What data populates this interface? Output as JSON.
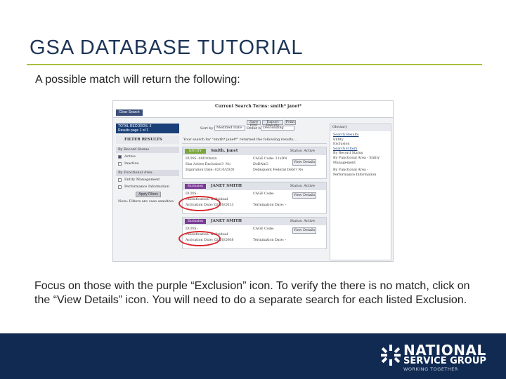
{
  "slide": {
    "title": "GSA DATABASE TUTORIAL",
    "intro": "A possible match will return the following:",
    "body": "Focus on those with the purple “Exclusion” icon.  To verify the there is no match, click on the “View Details” icon.   You will need to do a separate search for each listed Exclusion."
  },
  "screenshot": {
    "clear_search": "Clear Search",
    "search_terms": "Current Search Terms: smith* janet*",
    "total_records": "TOTAL RECORDS: 3",
    "results_page": "Results page 1 of 1",
    "sort_by_label": "Sort by",
    "sort_by_value": "Modified Date",
    "order_by_label": "Order by",
    "order_by_value": "Descending",
    "save_pdf": "Save PDF",
    "export_results": "Export Results",
    "print": "Print",
    "filter_results": "FILTER RESULTS",
    "returned_text": "Your search for \"smith* janet*\" returned the following results...",
    "record_status_hdr": "By Record Status",
    "active": "Active",
    "inactive": "Inactive",
    "functional_area_hdr": "By Functional Area",
    "entity_management": "Entity Management",
    "performance_information": "Performance Information",
    "apply_filters": "Apply Filters",
    "filters_note": "Note: Filters are case sensitive",
    "cards": [
      {
        "tag": "ENTITY",
        "name": "Smith, Janet",
        "status": "Status: Active",
        "duns": "DUNS: 00010xxxx",
        "cage": "CAGE Code: 11xDN",
        "has_excl": "Has Active Exclusion?: No",
        "dodaac": "DoDAAC:",
        "expiration": "Expiration Date: 02/10/2020",
        "delinquent": "Delinquent Federal Debt? No",
        "button": "View Details"
      },
      {
        "tag": "Exclusion",
        "name": "JANET SMITH",
        "status": "Status: Active",
        "duns": "DUNS:",
        "cage": "CAGE Code:",
        "classification": "Classification: Individual",
        "activation": "Activation Date: 02/20/2013",
        "termination": "Termination Date: -",
        "button": "View Details"
      },
      {
        "tag": "Exclusion",
        "name": "JANET SMITH",
        "status": "Status: Active",
        "duns": "DUNS:",
        "cage": "CAGE Code:",
        "classification": "Classification: Individual",
        "activation": "Activation Date: 02/20/2008",
        "termination": "Termination Date: -",
        "button": "View Details"
      }
    ],
    "glossary": {
      "header": "Glossary",
      "search_results": "Search Results",
      "entity": "Entity",
      "exclusion": "Exclusion",
      "search_filters": "Search Filters",
      "by_record_status": "By Record Status",
      "by_func_entity": "By Functional Area - Entity Management",
      "by_func_perf": "By Functional Area - Performance Information"
    }
  },
  "footer": {
    "logo_line1": "NATIONAL",
    "logo_line2": "SERVICE GROUP",
    "logo_line3": "WORKING TOGETHER"
  },
  "colors": {
    "title": "#1d3557",
    "rule": "#a7c040",
    "footer_bg": "#102a52",
    "exclusion_tag": "#7a3a96",
    "entity_tag": "#7aa63c",
    "highlight_oval": "#d6262b"
  }
}
